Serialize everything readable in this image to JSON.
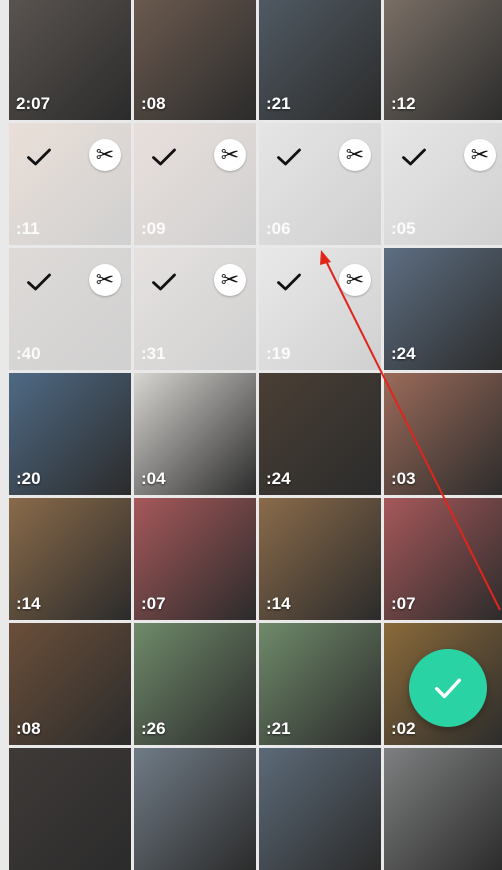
{
  "screen": {
    "title": ""
  },
  "tiles": [
    {
      "duration": "2:07",
      "selected": false,
      "bg": "#5a5450"
    },
    {
      "duration": ":08",
      "selected": false,
      "bg": "#6b5a4f"
    },
    {
      "duration": ":21",
      "selected": false,
      "bg": "#505a63"
    },
    {
      "duration": ":12",
      "selected": false,
      "bg": "#7a6f66"
    },
    {
      "duration": ":11",
      "selected": true,
      "bg": "#a07050"
    },
    {
      "duration": ":09",
      "selected": true,
      "bg": "#9a7060"
    },
    {
      "duration": ":06",
      "selected": true,
      "bg": "#8a8a8a"
    },
    {
      "duration": ":05",
      "selected": true,
      "bg": "#909090"
    },
    {
      "duration": ":40",
      "selected": true,
      "bg": "#6a5a50"
    },
    {
      "duration": ":31",
      "selected": true,
      "bg": "#8a7a72"
    },
    {
      "duration": ":19",
      "selected": true,
      "bg": "#9a9a9a"
    },
    {
      "duration": ":24",
      "selected": false,
      "bg": "#5e6f83"
    },
    {
      "duration": ":20",
      "selected": false,
      "bg": "#4f6a85"
    },
    {
      "duration": ":04",
      "selected": false,
      "bg": "#d8d6d2"
    },
    {
      "duration": ":24",
      "selected": false,
      "bg": "#4a3f35"
    },
    {
      "duration": ":03",
      "selected": false,
      "bg": "#9b6b5a"
    },
    {
      "duration": ":14",
      "selected": false,
      "bg": "#8a6b4a"
    },
    {
      "duration": ":07",
      "selected": false,
      "bg": "#a6585a"
    },
    {
      "duration": ":14",
      "selected": false,
      "bg": "#8a6b4a"
    },
    {
      "duration": ":07",
      "selected": false,
      "bg": "#a6585a"
    },
    {
      "duration": ":08",
      "selected": false,
      "bg": "#6b4f3a"
    },
    {
      "duration": ":26",
      "selected": false,
      "bg": "#6f8a6a"
    },
    {
      "duration": ":21",
      "selected": false,
      "bg": "#6f8a6a"
    },
    {
      "duration": ":02",
      "selected": false,
      "bg": "#8a6a3a"
    },
    {
      "duration": "",
      "selected": false,
      "bg": "#3f3a38"
    },
    {
      "duration": "",
      "selected": false,
      "bg": "#707b86"
    },
    {
      "duration": "",
      "selected": false,
      "bg": "#5c6a78"
    },
    {
      "duration": "",
      "selected": false,
      "bg": "#7e7f80"
    }
  ],
  "icons": {
    "check": "check-icon",
    "trim": "scissors-icon",
    "confirm": "check-icon"
  },
  "colors": {
    "fab": "#2ad3a4",
    "arrow": "#e1251b"
  }
}
